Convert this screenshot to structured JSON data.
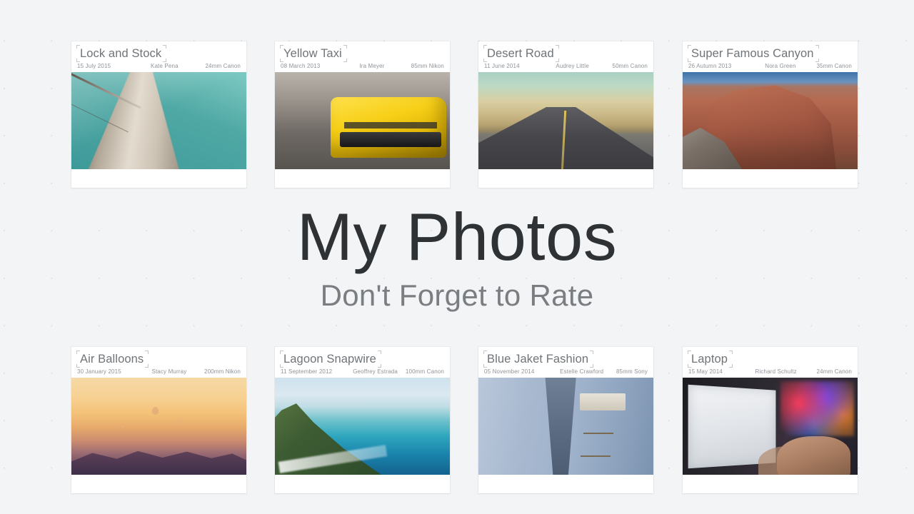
{
  "hero": {
    "title": "My Photos",
    "subtitle": "Don't Forget to Rate"
  },
  "theme": {
    "background": "#f3f4f5",
    "dot_color": "#d9dbdd",
    "card_background": "#ffffff",
    "title_color": "#2f3235",
    "subtitle_color": "#7a7e82",
    "card_title_color": "#6f7478",
    "card_meta_color": "#8f9499"
  },
  "cards": [
    {
      "title": "Lock and Stock",
      "date": "15 July 2015",
      "author": "Kate  Pena",
      "lens": "24mm Canon",
      "photo": "bridge-tower-teal"
    },
    {
      "title": "Yellow Taxi",
      "date": "08 March 2013",
      "author": "Ira Meyer",
      "lens": "85mm Nikon",
      "photo": "yellow-taxi-street"
    },
    {
      "title": "Desert Road",
      "date": "11 June 2014",
      "author": "Audrey  Little",
      "lens": "50mm Canon",
      "photo": "desert-road-dunes"
    },
    {
      "title": "Super Famous Canyon",
      "date": "26 Autumn 2013",
      "author": "Nora Green",
      "lens": "35mm Canon",
      "photo": "red-rock-canyon"
    },
    {
      "title": "Air Balloons",
      "date": "30 January 2015",
      "author": "Stacy  Murray",
      "lens": "200mm Nikon",
      "photo": "sunset-balloons"
    },
    {
      "title": "Lagoon Snapwire",
      "date": "11 September 2012",
      "author": "Geoffrey  Estrada",
      "lens": "100mm Canon",
      "photo": "tropical-lagoon"
    },
    {
      "title": "Blue Jaket Fashion",
      "date": "05 November 2014",
      "author": "Estelle Crawford",
      "lens": "85mm Sony",
      "photo": "blue-jacket"
    },
    {
      "title": "Laptop",
      "date": "15 May 2014",
      "author": "Richard Schultz",
      "lens": "24mm Canon",
      "photo": "laptop-desk"
    }
  ]
}
